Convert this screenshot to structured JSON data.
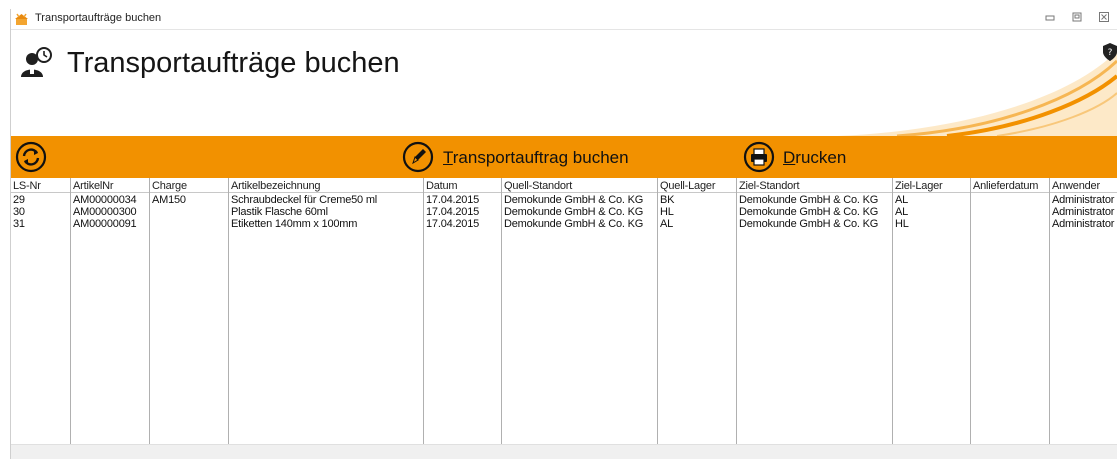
{
  "window": {
    "title": "Transportaufträge buchen",
    "controls": [
      "minimize-icon",
      "restore-icon",
      "close-icon"
    ]
  },
  "header": {
    "title": "Transportaufträge buchen"
  },
  "toolbar": {
    "refresh_icon": "refresh-icon",
    "book_prefix": "T",
    "book_rest": "ransportauftrag buchen",
    "print_prefix": "D",
    "print_rest": "rucken",
    "color": "#f29100"
  },
  "table": {
    "columns": [
      "LS-Nr",
      "ArtikelNr",
      "Charge",
      "Artikelbezeichnung",
      "Datum",
      "Quell-Standort",
      "Quell-Lager",
      "Ziel-Standort",
      "Ziel-Lager",
      "Anlieferdatum",
      "Anwender"
    ],
    "rows": [
      [
        "29",
        "AM00000034",
        "AM150",
        "Schraubdeckel für Creme50 ml",
        "17.04.2015",
        "Demokunde GmbH & Co. KG",
        "BK",
        "Demokunde GmbH & Co. KG",
        "AL",
        "",
        "Administrator"
      ],
      [
        "30",
        "AM00000300",
        "",
        "Plastik Flasche 60ml",
        "17.04.2015",
        "Demokunde GmbH & Co. KG",
        "HL",
        "Demokunde GmbH & Co. KG",
        "AL",
        "",
        "Administrator"
      ],
      [
        "31",
        "AM00000091",
        "",
        "Etiketten 140mm x 100mm",
        "17.04.2015",
        "Demokunde GmbH & Co. KG",
        "AL",
        "Demokunde GmbH & Co. KG",
        "HL",
        "",
        "Administrator"
      ]
    ]
  }
}
